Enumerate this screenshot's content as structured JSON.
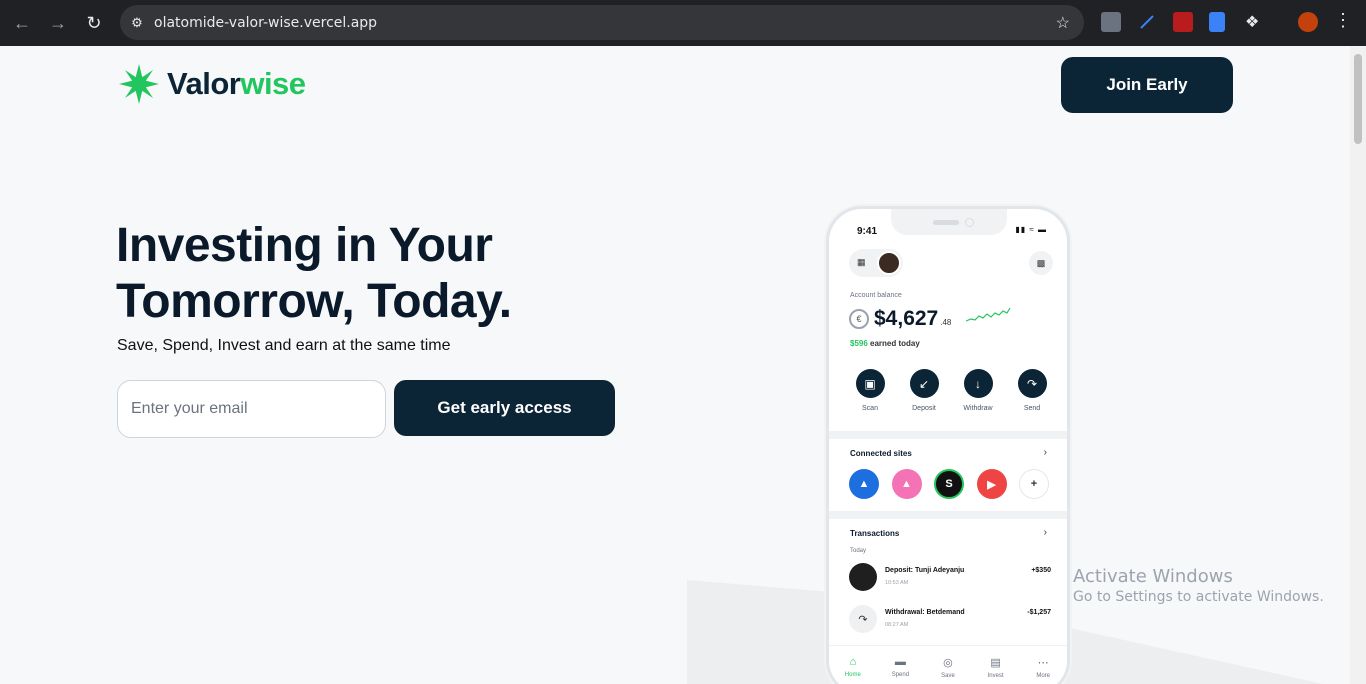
{
  "browser": {
    "url": "olatomide-valor-wise.vercel.app",
    "back_icon": "arrow-left-icon",
    "forward_icon": "arrow-right-icon",
    "reload_icon": "reload-icon",
    "bookmark_icon": "star-icon",
    "menu_icon": "kebab-icon"
  },
  "header": {
    "logo_part1": "Valor",
    "logo_part2": "wise",
    "join_label": "Join Early"
  },
  "hero": {
    "title_line1": "Investing in Your",
    "title_line2": "Tomorrow, Today.",
    "subtitle": "Save, Spend, Invest and earn at the same time",
    "email_placeholder": "Enter your email",
    "cta_label": "Get early access"
  },
  "phone": {
    "time": "9:41",
    "balance_label": "Account balance",
    "balance_main": "$4,627",
    "balance_cents": ".48",
    "earned_amount": "$596",
    "earned_text": " earned today",
    "actions": [
      {
        "label": "Scan",
        "icon": "scan-icon"
      },
      {
        "label": "Deposit",
        "icon": "deposit-icon"
      },
      {
        "label": "Withdraw",
        "icon": "withdraw-icon"
      },
      {
        "label": "Send",
        "icon": "send-icon"
      }
    ],
    "connected_title": "Connected sites",
    "transactions_title": "Transactions",
    "today_label": "Today",
    "transactions": [
      {
        "title": "Deposit: Tunji Adeyanju",
        "time": "10:53 AM",
        "amount": "+$350"
      },
      {
        "title": "Withdrawal: Betdemand",
        "time": "08:27 AM",
        "amount": "-$1,257"
      }
    ],
    "tabs": [
      {
        "label": "Home",
        "active": true
      },
      {
        "label": "Spend",
        "active": false
      },
      {
        "label": "Save",
        "active": false
      },
      {
        "label": "Invest",
        "active": false
      },
      {
        "label": "More",
        "active": false
      }
    ]
  },
  "watermark": {
    "title": "Activate Windows",
    "subtitle": "Go to Settings to activate Windows."
  },
  "colors": {
    "navy": "#0b2536",
    "green": "#22c55e"
  }
}
